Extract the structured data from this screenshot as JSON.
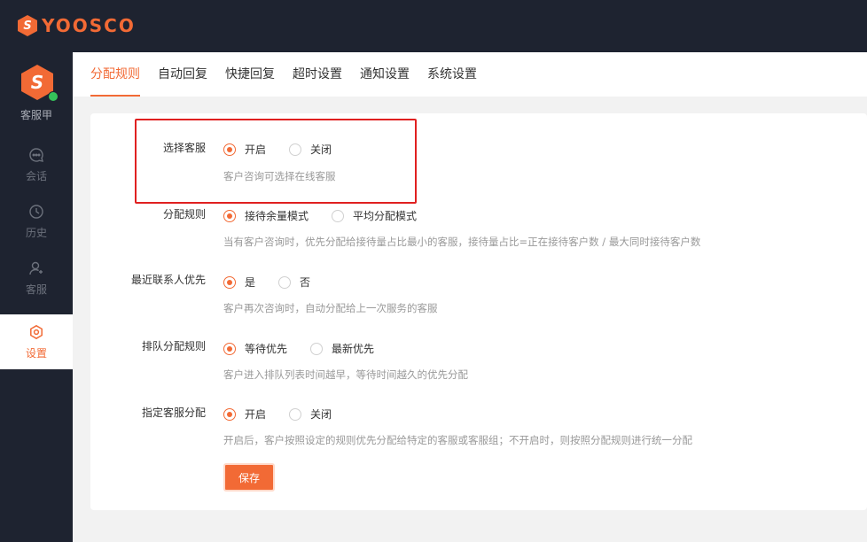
{
  "brand": {
    "logo_letter": "S",
    "name": "YOOSCO",
    "accent": "#f26a35"
  },
  "agent": {
    "avatar_letter": "S",
    "name": "客服甲",
    "status_color": "#35c35a"
  },
  "nav": [
    {
      "label": "会话",
      "icon": "chat-icon"
    },
    {
      "label": "历史",
      "icon": "clock-icon"
    },
    {
      "label": "客服",
      "icon": "user-icon"
    },
    {
      "label": "设置",
      "icon": "settings-icon",
      "active": true
    }
  ],
  "tabs": [
    {
      "label": "分配规则",
      "active": true
    },
    {
      "label": "自动回复"
    },
    {
      "label": "快捷回复"
    },
    {
      "label": "超时设置"
    },
    {
      "label": "通知设置"
    },
    {
      "label": "系统设置"
    }
  ],
  "settings": [
    {
      "label": "选择客服",
      "options": [
        "开启",
        "关闭"
      ],
      "selected": "开启",
      "hint": "客户咨询可选择在线客服"
    },
    {
      "label": "分配规则",
      "options": [
        "接待余量模式",
        "平均分配模式"
      ],
      "selected": "接待余量模式",
      "hint": "当有客户咨询时，优先分配给接待量占比最小的客服，接待量占比=正在接待客户数 / 最大同时接待客户数"
    },
    {
      "label": "最近联系人优先",
      "options": [
        "是",
        "否"
      ],
      "selected": "是",
      "hint": "客户再次咨询时，自动分配给上一次服务的客服"
    },
    {
      "label": "排队分配规则",
      "options": [
        "等待优先",
        "最新优先"
      ],
      "selected": "等待优先",
      "hint": "客户进入排队列表时间越早，等待时间越久的优先分配"
    },
    {
      "label": "指定客服分配",
      "options": [
        "开启",
        "关闭"
      ],
      "selected": "开启",
      "hint": "开启后，客户按照设定的规则优先分配给特定的客服或客服组；不开启时，则按照分配规则进行统一分配"
    }
  ],
  "save_label": "保存"
}
